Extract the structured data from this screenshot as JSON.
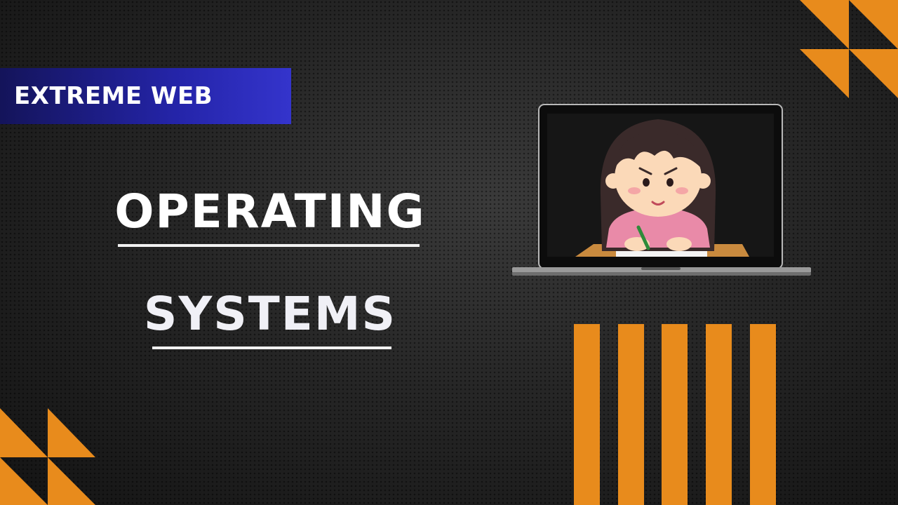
{
  "brand": {
    "label": "EXTREME WEB"
  },
  "title": {
    "line1": "OPERATING",
    "line2": "SYSTEMS"
  },
  "illustration": {
    "subject": "girl-studying-on-laptop"
  },
  "colors": {
    "accent_orange": "#e88b1c",
    "brand_blue": "#2a2ab8",
    "background": "#1e1e1e"
  }
}
